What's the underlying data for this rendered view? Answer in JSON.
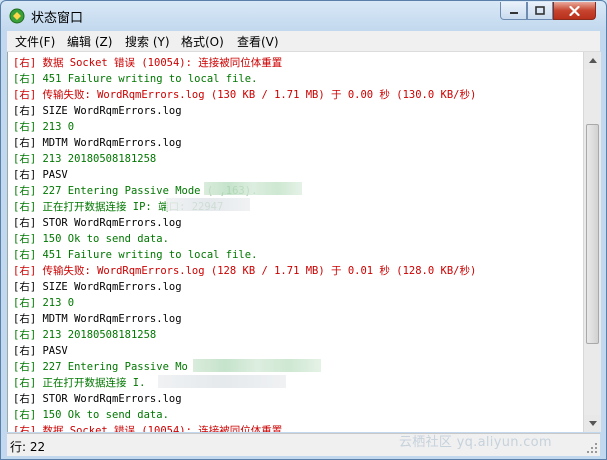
{
  "window": {
    "title": "状态窗口",
    "accent": "#5a7fa8"
  },
  "menu": [
    {
      "label": "文件(F)"
    },
    {
      "label": "编辑 (Z)"
    },
    {
      "label": "搜索 (Y)"
    },
    {
      "label": "格式(O)"
    },
    {
      "label": "查看(V)"
    }
  ],
  "log": {
    "colors": {
      "red": "#cc0000",
      "green": "#007700",
      "black": "#000000"
    },
    "lines": [
      {
        "text": "[右] 数据 Socket 错误 (10054): 连接被同位体重置",
        "color": "red"
      },
      {
        "text": "[右] 451 Failure writing to local file.",
        "color": "green"
      },
      {
        "text": "[右] 传输失败: WordRqmErrors.log (130 KB / 1.71 MB) 于 0.00 秒 (130.0 KB/秒)",
        "color": "red"
      },
      {
        "text": "[右] SIZE WordRqmErrors.log",
        "color": "black"
      },
      {
        "text": "[右] 213 0",
        "color": "green"
      },
      {
        "text": "[右] MDTM WordRqmErrors.log",
        "color": "black"
      },
      {
        "text": "[右] 213 20180508181258",
        "color": "green"
      },
      {
        "text": "[右] PASV",
        "color": "black"
      },
      {
        "text": "[右] 227 Entering Passive Mode (                ,163).",
        "color": "green"
      },
      {
        "text": "[右] 正在打开数据连接 IP:                端口: 22947",
        "color": "green"
      },
      {
        "text": "[右] STOR WordRqmErrors.log",
        "color": "black"
      },
      {
        "text": "[右] 150 Ok to send data.",
        "color": "green"
      },
      {
        "text": "[右] 451 Failure writing to local file.",
        "color": "green"
      },
      {
        "text": "[右] 传输失败: WordRqmErrors.log (128 KB / 1.71 MB) 于 0.01 秒 (128.0 KB/秒)",
        "color": "red"
      },
      {
        "text": "[右] SIZE WordRqmErrors.log",
        "color": "black"
      },
      {
        "text": "[右] 213 0",
        "color": "green"
      },
      {
        "text": "[右] MDTM WordRqmErrors.log",
        "color": "black"
      },
      {
        "text": "[右] 213 20180508181258",
        "color": "green"
      },
      {
        "text": "[右] PASV",
        "color": "black"
      },
      {
        "text": "[右] 227 Entering Passive Mo",
        "color": "green"
      },
      {
        "text": "[右] 正在打开数据连接 I.",
        "color": "green"
      },
      {
        "text": "[右] STOR WordRqmErrors.log",
        "color": "black"
      },
      {
        "text": "[右] 150 Ok to send data.",
        "color": "green"
      },
      {
        "text": "[右] 数据 Socket 错误 (10054): 连接被同位体重置",
        "color": "red"
      }
    ]
  },
  "status": {
    "text": "行: 22"
  },
  "watermark": {
    "text": "云栖社区 yq.aliyun.com"
  }
}
